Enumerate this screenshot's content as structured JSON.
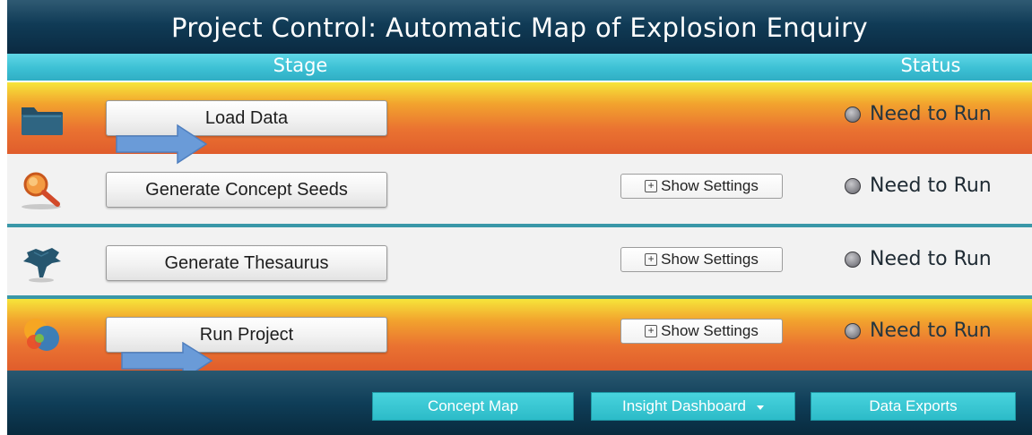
{
  "window": {
    "title": "Project Control: Automatic Map of Explosion Enquiry"
  },
  "header": {
    "stage_label": "Stage",
    "status_label": "Status"
  },
  "stages": [
    {
      "icon": "folder-icon",
      "label": "Load Data",
      "has_settings": false,
      "status": "Need to Run",
      "highlighted": true
    },
    {
      "icon": "magnifier-icon",
      "label": "Generate Concept Seeds",
      "has_settings": true,
      "settings_label": "Show Settings",
      "status": "Need to Run",
      "highlighted": false
    },
    {
      "icon": "thesaurus-tree-icon",
      "label": "Generate Thesaurus",
      "has_settings": true,
      "settings_label": "Show Settings",
      "status": "Need to Run",
      "highlighted": false
    },
    {
      "icon": "run-project-icon",
      "label": "Run Project",
      "has_settings": true,
      "settings_label": "Show Settings",
      "status": "Need to Run",
      "highlighted": true
    }
  ],
  "footer": {
    "buttons": [
      {
        "label": "Concept Map"
      },
      {
        "label": "Insight Dashboard",
        "has_dropdown": true
      },
      {
        "label": "Data Exports"
      }
    ]
  },
  "colors": {
    "title_bg": "#103b56",
    "header_bg": "#3cc0d4",
    "highlight_row": "#ea7331",
    "normal_row": "#f2f2f2",
    "footer_button": "#2cbbc8",
    "arrow": "#6a9bd8"
  }
}
